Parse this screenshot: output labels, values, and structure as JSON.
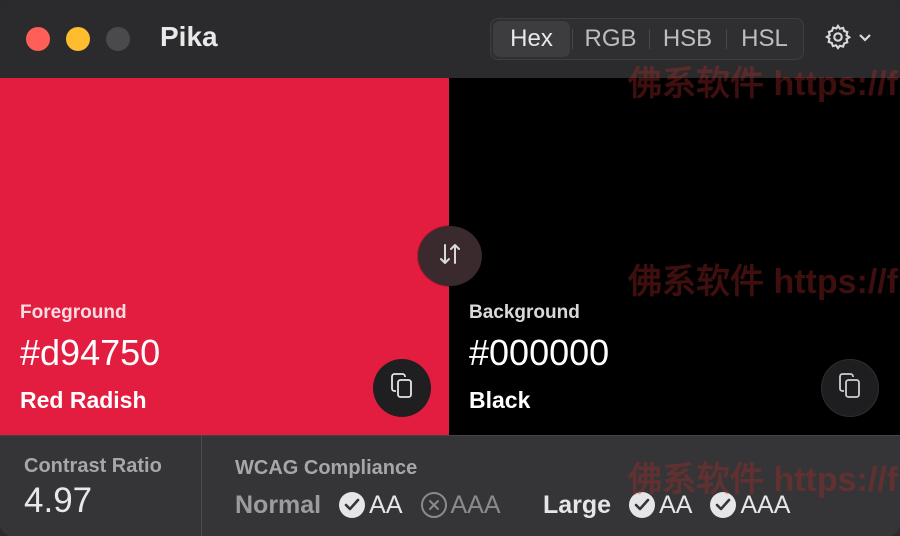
{
  "app": {
    "title": "Pika"
  },
  "formats": [
    "Hex",
    "RGB",
    "HSB",
    "HSL"
  ],
  "active_format": "Hex",
  "foreground": {
    "label": "Foreground",
    "hex": "#d94750",
    "name": "Red Radish",
    "color": "#e21d3f"
  },
  "background": {
    "label": "Background",
    "hex": "#000000",
    "name": "Black",
    "color": "#000000"
  },
  "contrast": {
    "label": "Contrast Ratio",
    "value": "4.97"
  },
  "wcag": {
    "label": "WCAG Compliance",
    "normal": {
      "label": "Normal",
      "aa": "AA",
      "aaa": "AAA",
      "aa_pass": true,
      "aaa_pass": false
    },
    "large": {
      "label": "Large",
      "aa": "AA",
      "aaa": "AAA",
      "aa_pass": true,
      "aaa_pass": true
    }
  },
  "watermark": "佛系软件 https://f"
}
